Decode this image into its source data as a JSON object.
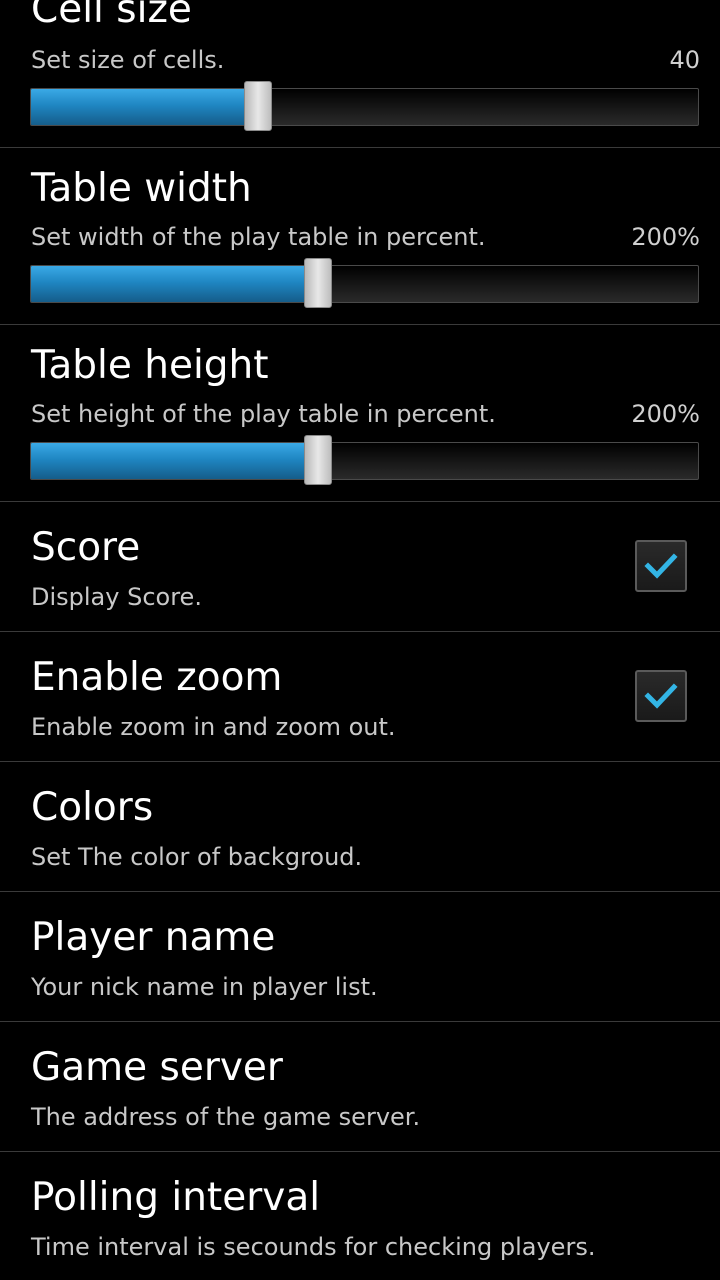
{
  "preferences": {
    "cell_size": {
      "title": "Cell size",
      "summary": "Set size of cells.",
      "value_label": "40",
      "fraction": 0.34
    },
    "table_width": {
      "title": "Table width",
      "summary": "Set width of the play table in percent.",
      "value_label": "200%",
      "fraction": 0.43
    },
    "table_height": {
      "title": "Table height",
      "summary": "Set height of the play table in percent.",
      "value_label": "200%",
      "fraction": 0.43
    },
    "score": {
      "title": "Score",
      "summary": "Display Score.",
      "checked": true
    },
    "enable_zoom": {
      "title": "Enable zoom",
      "summary": "Enable zoom in and zoom out.",
      "checked": true
    },
    "colors": {
      "title": "Colors",
      "summary": "Set The color of backgroud."
    },
    "player_name": {
      "title": "Player name",
      "summary": "Your nick name in player list."
    },
    "game_server": {
      "title": "Game server",
      "summary": "The address of the game server."
    },
    "polling_interval": {
      "title": "Polling interval",
      "summary": "Time interval is secounds for checking players."
    }
  },
  "colors": {
    "accent": "#33b5e5",
    "background": "#000000",
    "divider": "#3a3a3a"
  },
  "icons": {
    "checkmark": "checkmark-icon"
  }
}
